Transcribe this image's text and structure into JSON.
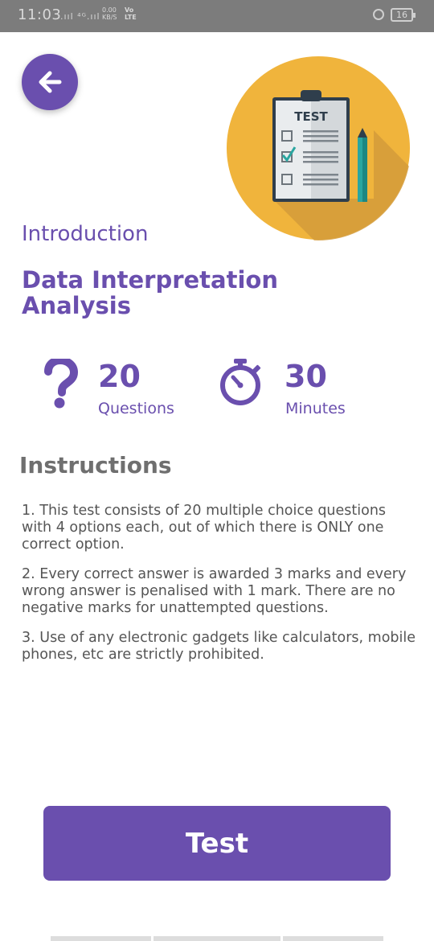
{
  "status_bar": {
    "time": "11:03",
    "signal": ".ııl ⁴ᴳ.ııl",
    "net_speed": "0.00\nKB/S",
    "volte": "Vo\nLTE",
    "battery": "16"
  },
  "back_button": {
    "icon": "arrow-left-icon"
  },
  "hero_image": {
    "label": "TEST",
    "icon": "test-clipboard-icon"
  },
  "intro_label": "Introduction",
  "topic_title": "Data Interpretation Analysis",
  "stats": [
    {
      "icon": "question-mark-icon",
      "value": "20",
      "label": "Questions"
    },
    {
      "icon": "stopwatch-icon",
      "value": "30",
      "label": "Minutes"
    }
  ],
  "instructions": {
    "heading": "Instructions",
    "items": [
      "1. This test consists of 20 multiple choice questions with 4 options each, out of which there is ONLY one correct option.",
      "2. Every correct answer is awarded 3 marks and every wrong answer is penalised with 1 mark. There are no negative marks for unattempted questions.",
      "3. Use of any electronic gadgets like calculators, mobile phones, etc are strictly prohibited."
    ]
  },
  "test_button_label": "Test",
  "colors": {
    "accent": "#6a4fae",
    "hero_bg": "#f0b43c",
    "heading_gray": "#6f6f6f"
  }
}
